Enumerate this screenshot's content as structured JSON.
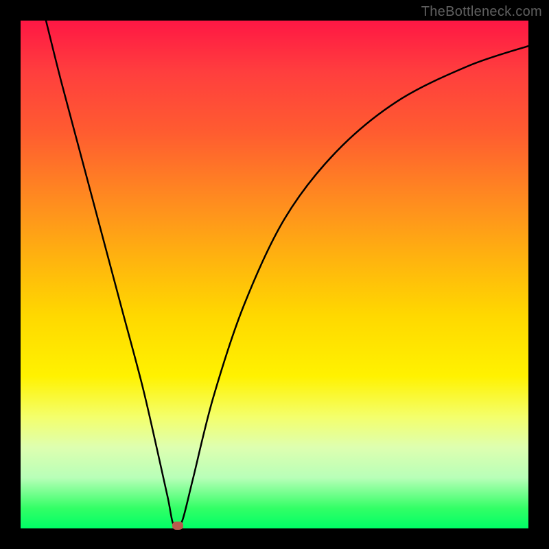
{
  "watermark": "TheBottleneck.com",
  "chart_data": {
    "type": "line",
    "title": "",
    "xlabel": "",
    "ylabel": "",
    "xlim": [
      0,
      100
    ],
    "ylim": [
      0,
      100
    ],
    "grid": false,
    "series": [
      {
        "name": "bottleneck-curve",
        "x": [
          5,
          8,
          12,
          16,
          20,
          24,
          27,
          29,
          30,
          31,
          32,
          34,
          38,
          44,
          52,
          62,
          74,
          88,
          100
        ],
        "values": [
          100,
          88,
          73,
          58,
          43,
          28,
          15,
          6,
          1,
          0.5,
          2,
          10,
          26,
          44,
          61,
          74,
          84,
          91,
          95
        ]
      }
    ],
    "marker": {
      "x": 31,
      "y": 0.5,
      "color": "#b95a4e"
    },
    "gradient_stops": [
      {
        "pos": 0,
        "color": "#ff1744"
      },
      {
        "pos": 10,
        "color": "#ff3e3e"
      },
      {
        "pos": 22,
        "color": "#ff5c30"
      },
      {
        "pos": 35,
        "color": "#ff8a20"
      },
      {
        "pos": 46,
        "color": "#ffb010"
      },
      {
        "pos": 58,
        "color": "#ffd800"
      },
      {
        "pos": 70,
        "color": "#fff200"
      },
      {
        "pos": 78,
        "color": "#f4ff6b"
      },
      {
        "pos": 84,
        "color": "#deffb0"
      },
      {
        "pos": 90,
        "color": "#b8ffb8"
      },
      {
        "pos": 96,
        "color": "#33ff66"
      },
      {
        "pos": 100,
        "color": "#00ff66"
      }
    ]
  }
}
